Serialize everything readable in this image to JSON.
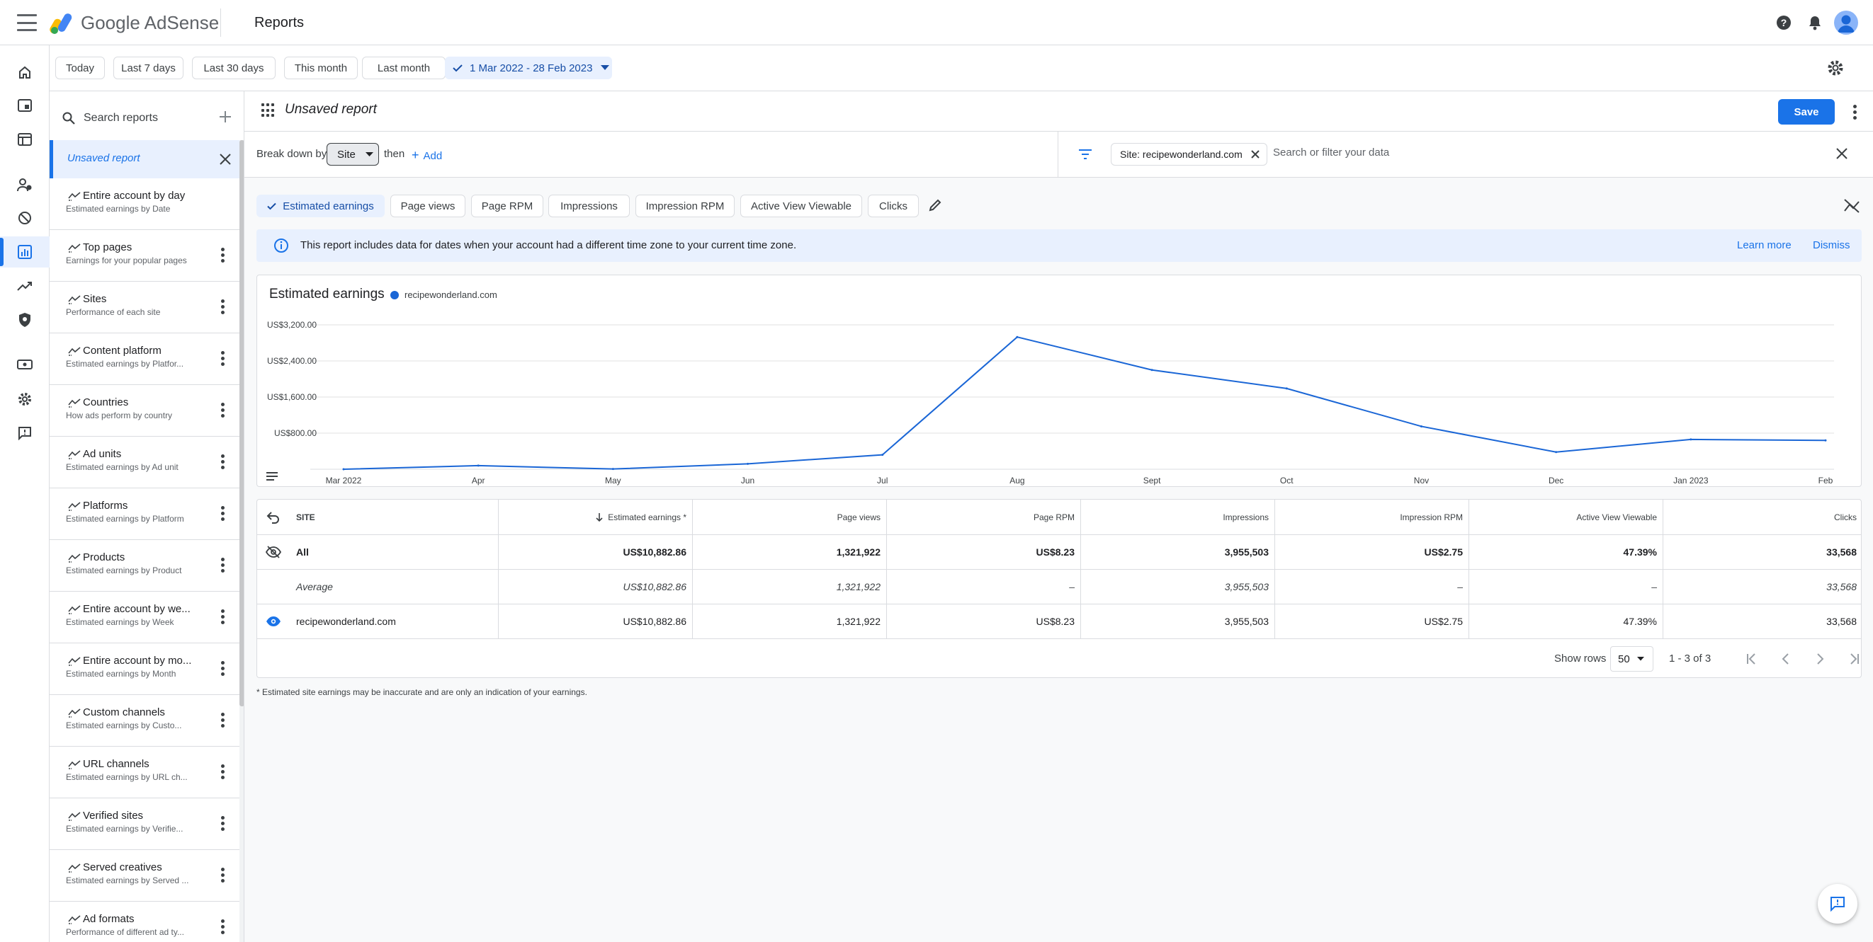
{
  "app": {
    "brand": "Google AdSense",
    "page_title": "Reports"
  },
  "colors": {
    "accent": "#1a73e8",
    "series": "#1a66d6",
    "selected_chip": "#e8f0fe"
  },
  "topbar_icons": [
    "menu-icon",
    "help-icon",
    "notifications-icon",
    "account-avatar"
  ],
  "rail": [
    "home-icon",
    "ads-icon",
    "sites-icon",
    "users-icon",
    "block-icon",
    "reports-icon",
    "optimization-icon",
    "privacy-icon",
    "payments-icon",
    "settings-icon",
    "feedback-icon"
  ],
  "date_chips": [
    "Today",
    "Last 7 days",
    "Last 30 days",
    "This month",
    "Last month"
  ],
  "date_range": "1 Mar 2022 - 28 Feb 2023",
  "sidebar": {
    "search_placeholder": "Search reports",
    "active_item": "Unsaved report",
    "items": [
      {
        "title": "Entire account by day",
        "subtitle": "Estimated earnings by Date"
      },
      {
        "title": "Top pages",
        "subtitle": "Earnings for your popular pages"
      },
      {
        "title": "Sites",
        "subtitle": "Performance of each site"
      },
      {
        "title": "Content platform",
        "subtitle": "Estimated earnings by Platfor..."
      },
      {
        "title": "Countries",
        "subtitle": "How ads perform by country"
      },
      {
        "title": "Ad units",
        "subtitle": "Estimated earnings by Ad unit"
      },
      {
        "title": "Platforms",
        "subtitle": "Estimated earnings by Platform"
      },
      {
        "title": "Products",
        "subtitle": "Estimated earnings by Product"
      },
      {
        "title": "Entire account by we...",
        "subtitle": "Estimated earnings by Week"
      },
      {
        "title": "Entire account by mo...",
        "subtitle": "Estimated earnings by Month"
      },
      {
        "title": "Custom channels",
        "subtitle": "Estimated earnings by Custo..."
      },
      {
        "title": "URL channels",
        "subtitle": "Estimated earnings by URL ch..."
      },
      {
        "title": "Verified sites",
        "subtitle": "Estimated earnings by Verifie..."
      },
      {
        "title": "Served creatives",
        "subtitle": "Estimated earnings by Served ..."
      },
      {
        "title": "Ad formats",
        "subtitle": "Performance of different ad ty..."
      }
    ]
  },
  "report": {
    "title": "Unsaved report",
    "save_label": "Save",
    "breakdown_label": "Break down by",
    "breakdown_value": "Site",
    "then_label": "then",
    "add_label": "Add",
    "filter_chip": "Site: recipewonderland.com",
    "filter_placeholder": "Search or filter your data",
    "metrics": [
      "Estimated earnings",
      "Page views",
      "Page RPM",
      "Impressions",
      "Impression RPM",
      "Active View Viewable",
      "Clicks"
    ],
    "info_text": "This report includes data for dates when your account had a different time zone to your current time zone.",
    "learn_more": "Learn more",
    "dismiss": "Dismiss"
  },
  "chart_data": {
    "type": "line",
    "title": "Estimated earnings",
    "series": [
      {
        "name": "recipewonderland.com",
        "values": [
          0,
          80,
          5,
          120,
          320,
          2930,
          2200,
          1790,
          950,
          380,
          660,
          640
        ]
      }
    ],
    "x": [
      "Mar 2022",
      "Apr",
      "May",
      "Jun",
      "Jul",
      "Aug",
      "Sept",
      "Oct",
      "Nov",
      "Dec",
      "Jan 2023",
      "Feb"
    ],
    "yticks": [
      "US$800.00",
      "US$1,600.00",
      "US$2,400.00",
      "US$3,200.00"
    ],
    "ytick_values": [
      800,
      1600,
      2400,
      3200
    ],
    "ylim": [
      0,
      3200
    ],
    "grid": true,
    "legend": "top-left"
  },
  "table": {
    "headers": [
      "SITE",
      "Estimated earnings *",
      "Page views",
      "Page RPM",
      "Impressions",
      "Impression RPM",
      "Active View Viewable",
      "Clicks"
    ],
    "rows": [
      {
        "cells": [
          "All",
          "US$10,882.86",
          "1,321,922",
          "US$8.23",
          "3,955,503",
          "US$2.75",
          "47.39%",
          "33,568"
        ]
      },
      {
        "cells": [
          "Average",
          "US$10,882.86",
          "1,321,922",
          "–",
          "3,955,503",
          "–",
          "–",
          "33,568"
        ]
      },
      {
        "cells": [
          "recipewonderland.com",
          "US$10,882.86",
          "1,321,922",
          "US$8.23",
          "3,955,503",
          "US$2.75",
          "47.39%",
          "33,568"
        ]
      }
    ],
    "show_rows_label": "Show rows",
    "show_rows_value": "50",
    "range_label": "1 - 3 of 3"
  },
  "footnote": "* Estimated site earnings may be inaccurate and are only an indication of your earnings."
}
